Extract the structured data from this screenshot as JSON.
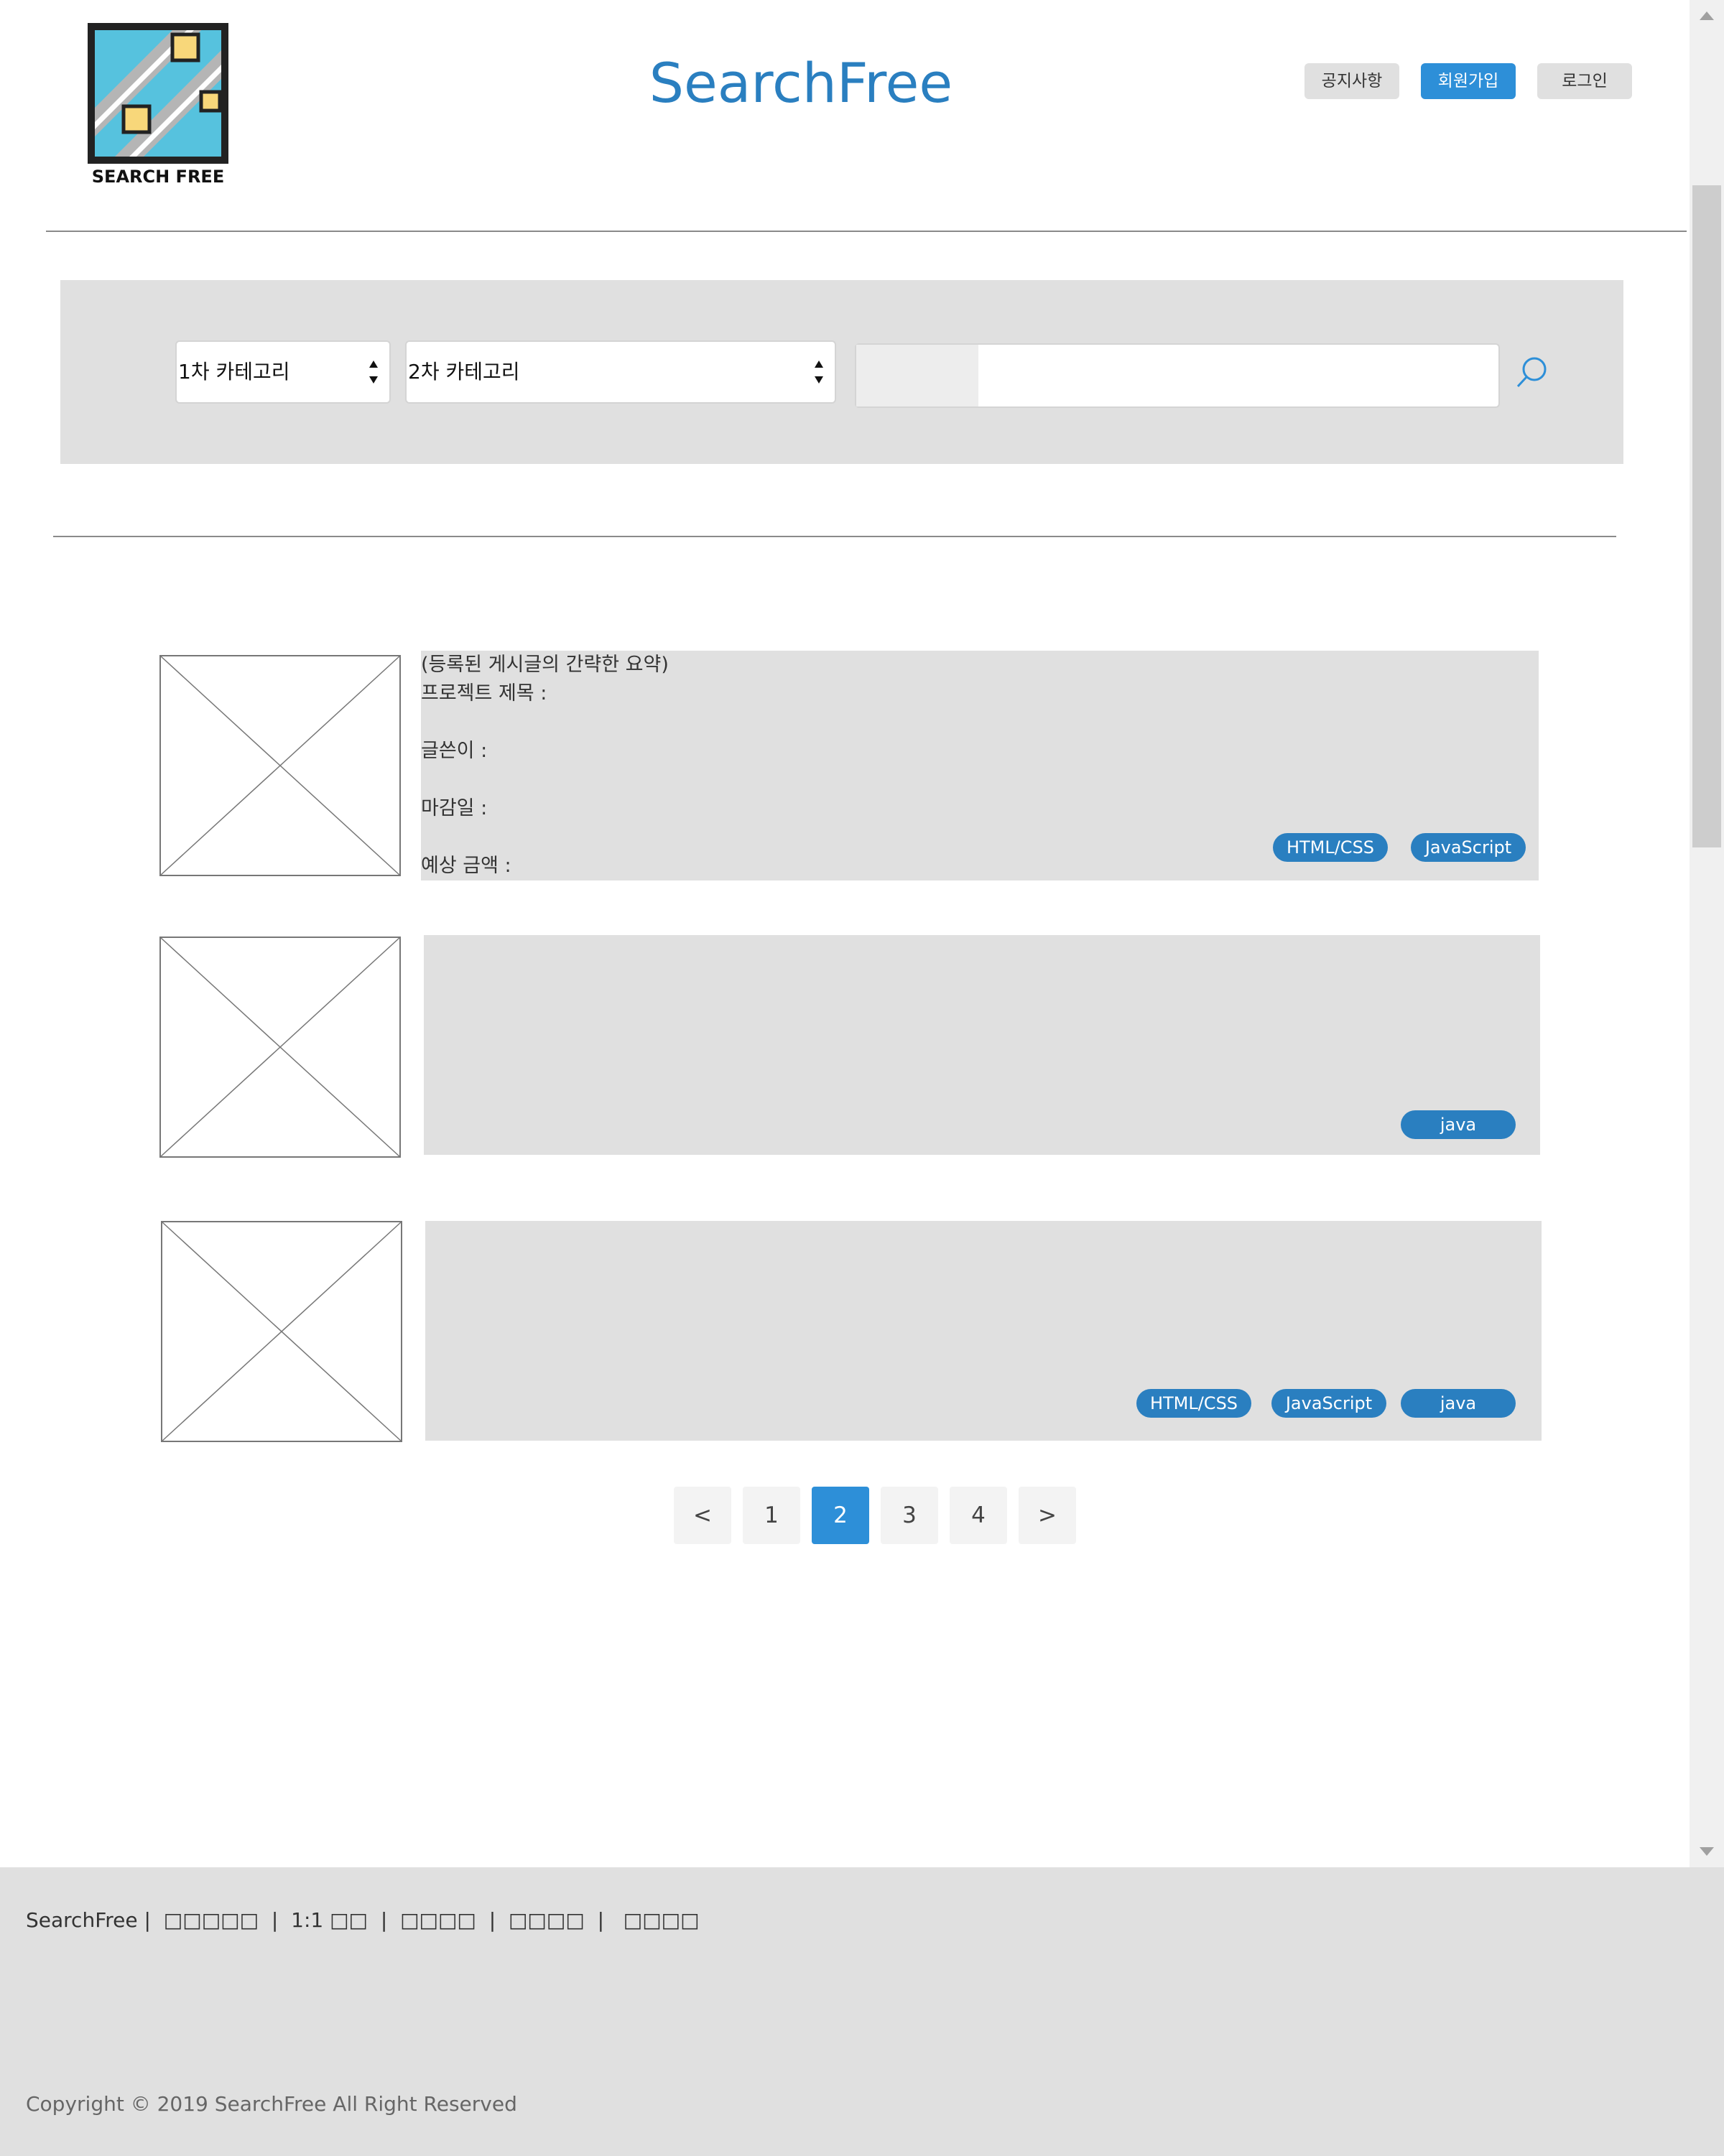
{
  "header": {
    "logo_text": "SEARCH FREE",
    "site_title": "SearchFree",
    "buttons": {
      "notice": "공지사항",
      "signup": "회원가입",
      "login": "로그인"
    }
  },
  "search": {
    "category1": "1차 카테고리",
    "category2": "2차 카테고리",
    "query": ""
  },
  "posts": [
    {
      "summary": "(등록된 게시글의 간략한 요약)\n프로젝트 제목 :\n\n글쓴이 :\n\n마감일 :\n\n예상 금액 :",
      "tags": [
        "HTML/CSS",
        "JavaScript"
      ]
    },
    {
      "summary": "",
      "tags": [
        "java"
      ]
    },
    {
      "summary": "",
      "tags": [
        "HTML/CSS",
        "JavaScript",
        "java"
      ]
    }
  ],
  "pagination": {
    "prev": "<",
    "pages": [
      "1",
      "2",
      "3",
      "4"
    ],
    "current": "2",
    "next": ">"
  },
  "footer": {
    "links": [
      "SearchFree",
      "□□□□□",
      "1:1 □□",
      "□□□□",
      "□□□□",
      "□□□□"
    ],
    "separator": "|",
    "copyright": "Copyright © 2019 SearchFree All Right Reserved"
  },
  "colors": {
    "accent": "#2a7fc0",
    "button_active": "#2d8fd8",
    "panel": "#e0e0e0"
  }
}
